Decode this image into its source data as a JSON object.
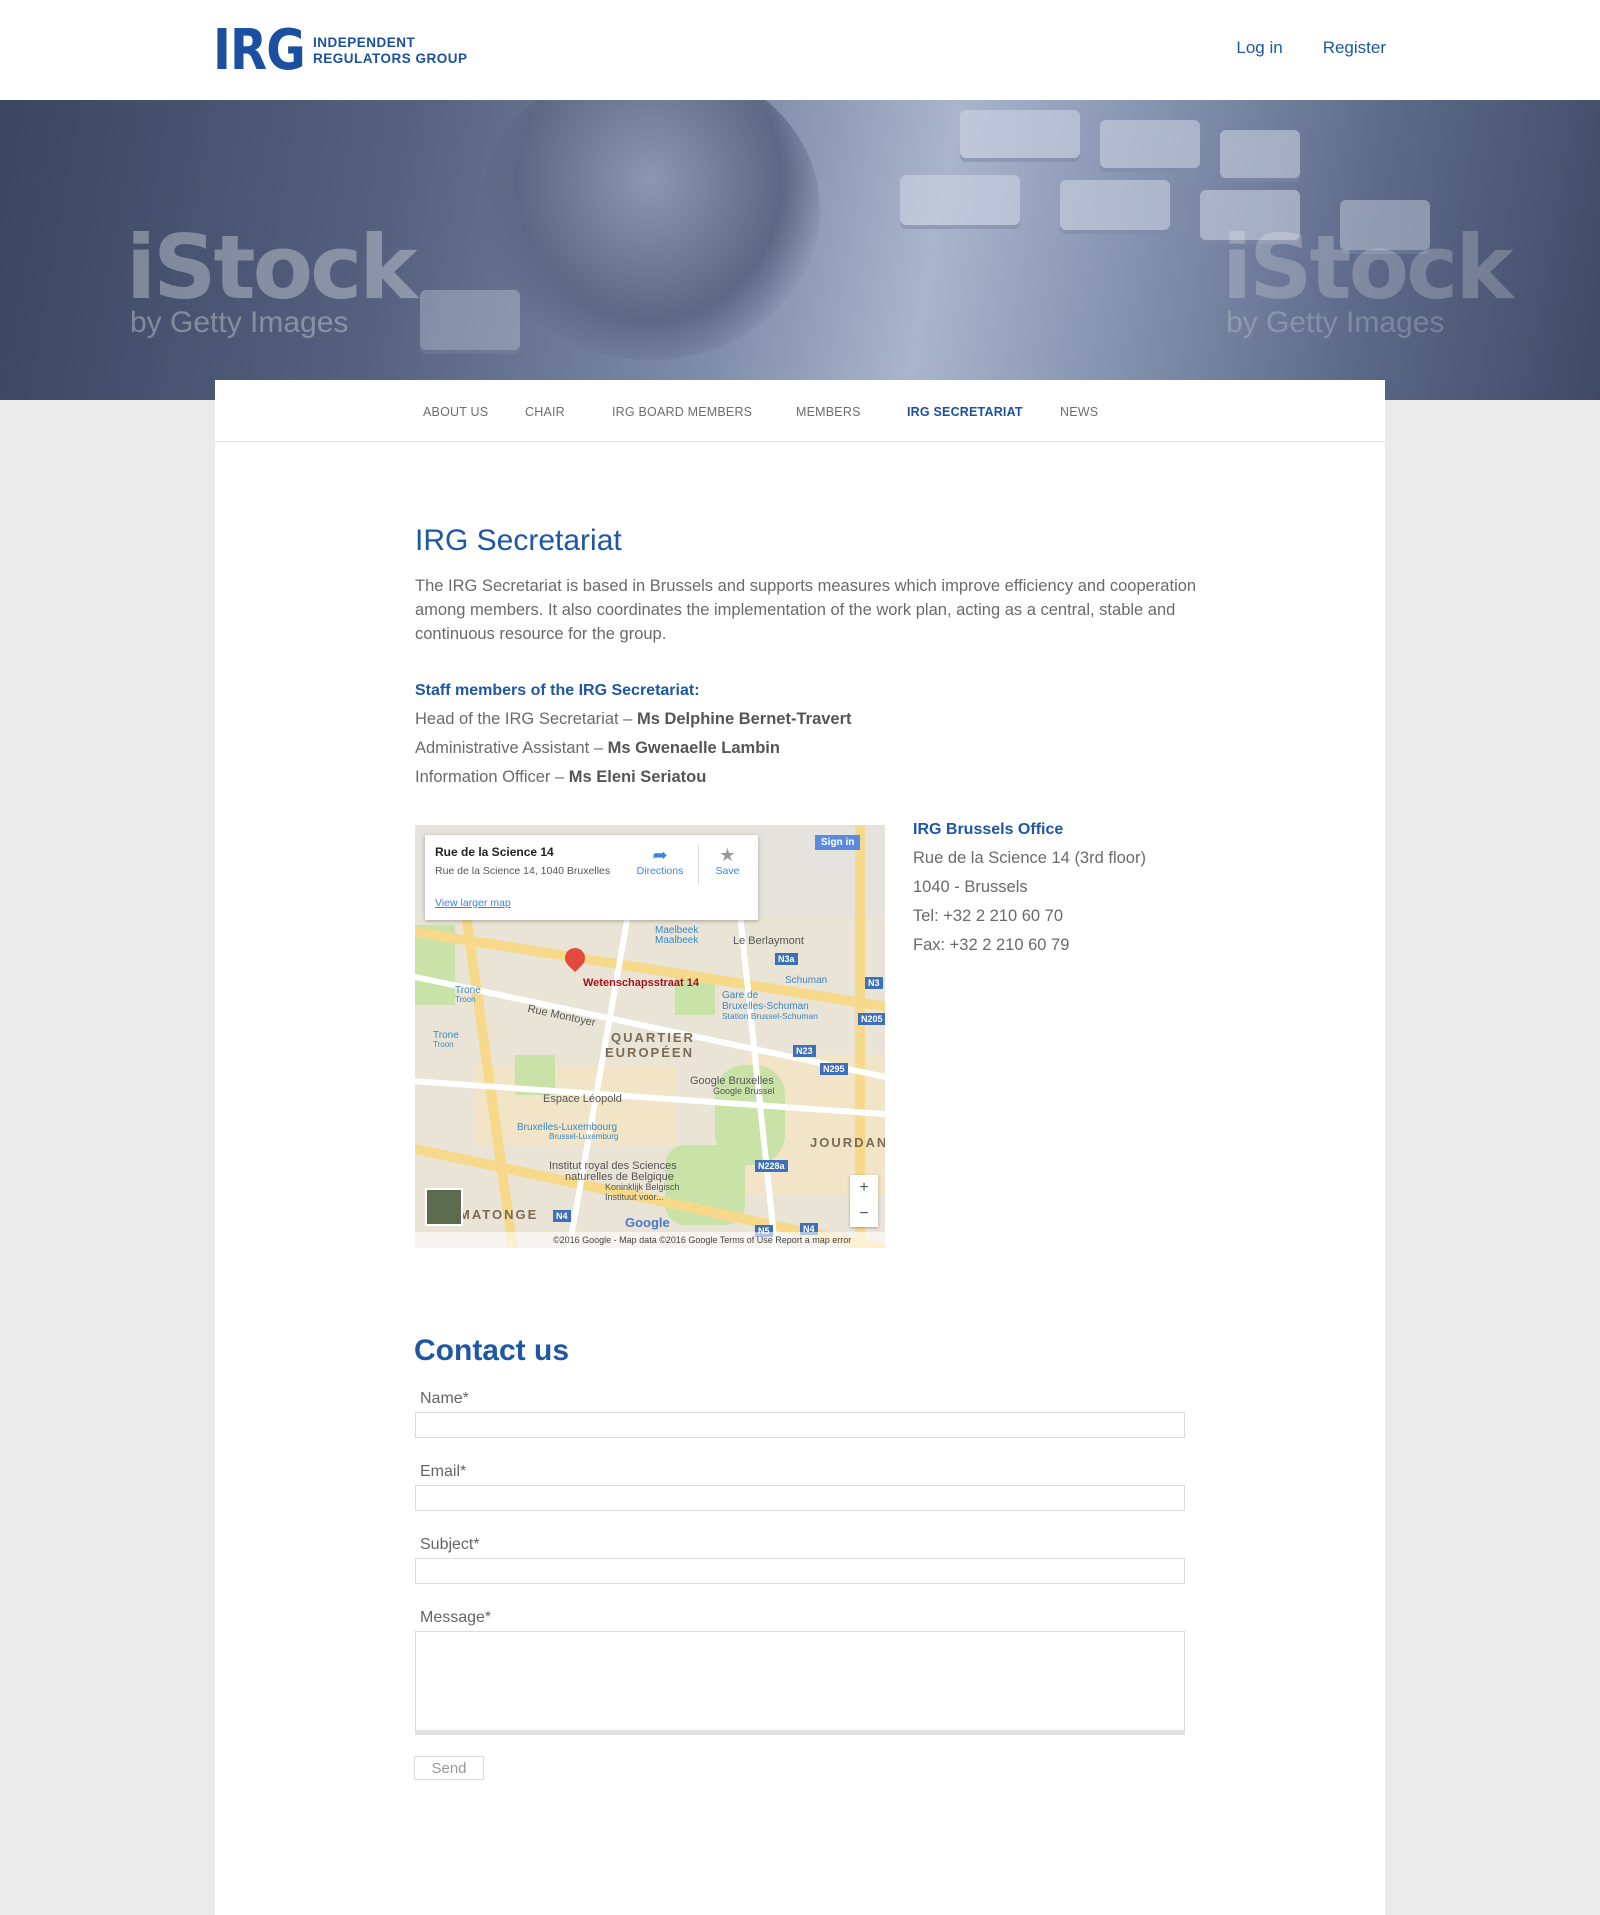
{
  "header": {
    "logo_mark": "IRG",
    "logo_line1": "INDEPENDENT",
    "logo_line2": "REGULATORS GROUP",
    "login": "Log in",
    "register": "Register"
  },
  "hero": {
    "watermark_main": "iStock",
    "watermark_sub": "by Getty Images"
  },
  "nav": {
    "items": [
      {
        "label": "ABOUT US"
      },
      {
        "label": "CHAIR"
      },
      {
        "label": "IRG BOARD MEMBERS"
      },
      {
        "label": "MEMBERS"
      },
      {
        "label": "IRG SECRETARIAT"
      },
      {
        "label": "NEWS"
      }
    ],
    "active": "IRG SECRETARIAT"
  },
  "main": {
    "title": "IRG Secretariat",
    "intro": "The IRG Secretariat is based in Brussels and supports measures which improve efficiency and cooperation among  members. It also coordinates the implementation of the work plan, acting as a central, stable and continuous resource for the group.",
    "staff_heading": "Staff members of the IRG Secretariat:",
    "staff": [
      {
        "role": "Head of the IRG Secretariat – ",
        "name": "Ms Delphine Bernet-Travert"
      },
      {
        "role": "Administrative Assistant – ",
        "name": "Ms Gwenaelle Lambin"
      },
      {
        "role": "Information Officer – ",
        "name": "Ms Eleni Seriatou"
      }
    ]
  },
  "map": {
    "popup_title": "Rue de la Science 14",
    "popup_address": "Rue de la Science 14, 1040 Bruxelles",
    "popup_link": "View larger map",
    "directions": "Directions",
    "save": "Save",
    "sign_in": "Sign in",
    "pin_label": "Wetenschapsstraat 14",
    "labels": {
      "le_berlaymont": "Le Berlaymont",
      "maelbeek": "Maelbeek",
      "maelbeek2": "Maalbeek",
      "schuman": "Schuman",
      "gare": "Gare de",
      "gare2": "Bruxelles-Schuman",
      "gare3": "Station Brussel-Schuman",
      "trone": "Trone",
      "trone2": "Troon",
      "rue_montoyer": "Rue Montoyer",
      "quartier": "QUARTIER",
      "europeen": "EUROPÉEN",
      "google_brux": "Google Bruxelles",
      "google_brus": "Google Brussel",
      "espace": "Espace Léopold",
      "brux_lux": "Bruxelles-Luxembourg",
      "brus_lux": "Brussel-Luxemburg",
      "jourdan": "JOURDAN",
      "institut": "Institut royal des Sciences",
      "institut2": "naturelles de Belgique",
      "institut3": "Koninklijk Belgisch",
      "institut4": "Instituut voor...",
      "matonge": "MATONGE",
      "google": "Google",
      "footer": "©2016 Google - Map data ©2016 Google   Terms of Use   Report a map error"
    },
    "badges": [
      "N3a",
      "N3",
      "N205",
      "N23",
      "N295",
      "N228a",
      "N4",
      "N5",
      "N4"
    ]
  },
  "office": {
    "title": "IRG Brussels Office",
    "address": "Rue de la Science 14 (3rd floor)",
    "city": "1040 - Brussels",
    "tel": "Tel: +32 2 210 60 70",
    "fax": "Fax: +32 2 210 60 79"
  },
  "contact": {
    "title": "Contact us",
    "name_label": "Name*",
    "email_label": "Email*",
    "subject_label": "Subject*",
    "message_label": "Message*",
    "send": "Send"
  },
  "colors": {
    "brand_blue": "#1e57a4",
    "background": "#ebebeb"
  }
}
